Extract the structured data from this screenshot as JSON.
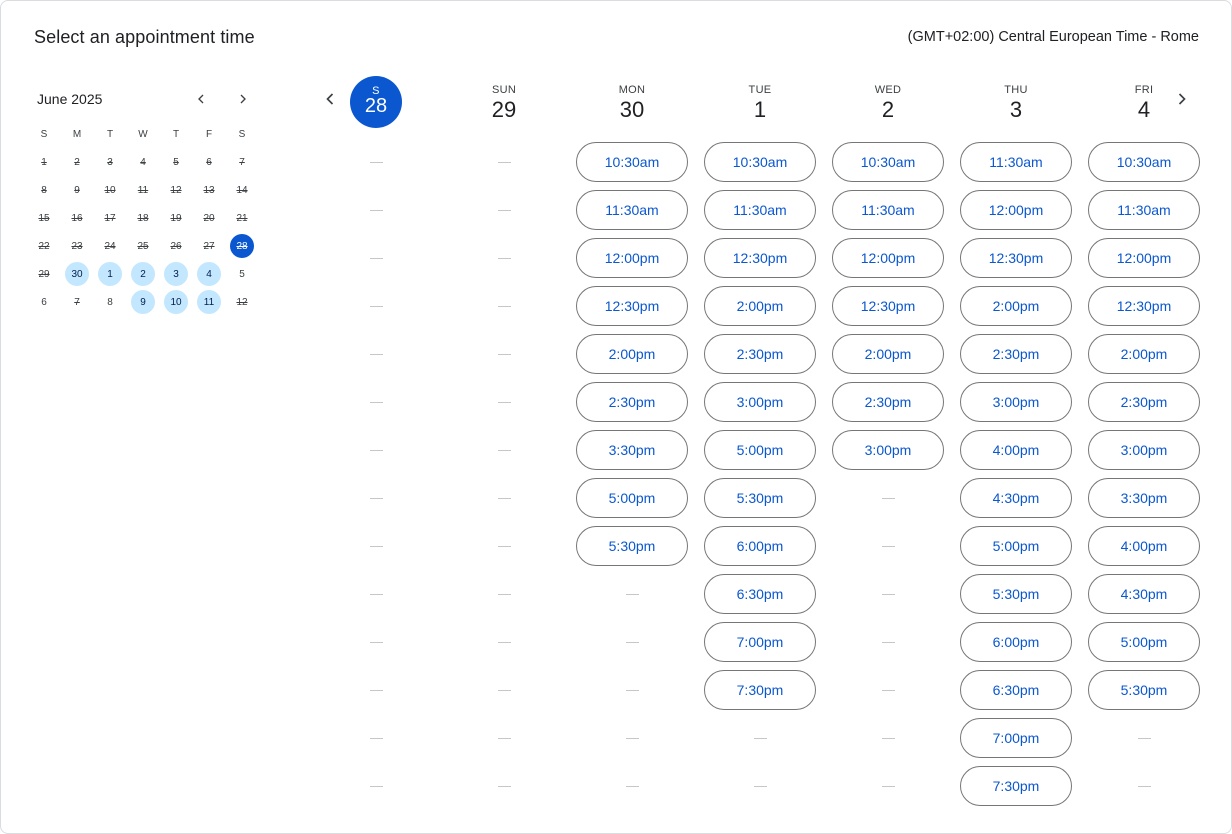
{
  "header": {
    "title": "Select an appointment time",
    "timezone": "(GMT+02:00) Central European Time - Rome"
  },
  "mini_calendar": {
    "month_label": "June 2025",
    "prev_icon": "chevron-left-icon",
    "next_icon": "chevron-right-icon",
    "weekdays": [
      "S",
      "M",
      "T",
      "W",
      "T",
      "F",
      "S"
    ],
    "weeks": [
      [
        {
          "d": "1",
          "s": "unavail"
        },
        {
          "d": "2",
          "s": "unavail"
        },
        {
          "d": "3",
          "s": "unavail"
        },
        {
          "d": "4",
          "s": "unavail"
        },
        {
          "d": "5",
          "s": "unavail"
        },
        {
          "d": "6",
          "s": "unavail"
        },
        {
          "d": "7",
          "s": "unavail"
        }
      ],
      [
        {
          "d": "8",
          "s": "unavail"
        },
        {
          "d": "9",
          "s": "unavail"
        },
        {
          "d": "10",
          "s": "unavail"
        },
        {
          "d": "11",
          "s": "unavail"
        },
        {
          "d": "12",
          "s": "unavail"
        },
        {
          "d": "13",
          "s": "unavail"
        },
        {
          "d": "14",
          "s": "unavail"
        }
      ],
      [
        {
          "d": "15",
          "s": "unavail"
        },
        {
          "d": "16",
          "s": "unavail"
        },
        {
          "d": "17",
          "s": "unavail"
        },
        {
          "d": "18",
          "s": "unavail"
        },
        {
          "d": "19",
          "s": "unavail"
        },
        {
          "d": "20",
          "s": "unavail"
        },
        {
          "d": "21",
          "s": "unavail"
        }
      ],
      [
        {
          "d": "22",
          "s": "unavail"
        },
        {
          "d": "23",
          "s": "unavail"
        },
        {
          "d": "24",
          "s": "unavail"
        },
        {
          "d": "25",
          "s": "unavail"
        },
        {
          "d": "26",
          "s": "unavail"
        },
        {
          "d": "27",
          "s": "unavail"
        },
        {
          "d": "28",
          "s": "selected"
        }
      ],
      [
        {
          "d": "29",
          "s": "unavail"
        },
        {
          "d": "30",
          "s": "avail"
        },
        {
          "d": "1",
          "s": "avail"
        },
        {
          "d": "2",
          "s": "avail"
        },
        {
          "d": "3",
          "s": "avail"
        },
        {
          "d": "4",
          "s": "avail"
        },
        {
          "d": "5",
          "s": "plain"
        }
      ],
      [
        {
          "d": "6",
          "s": "plain"
        },
        {
          "d": "7",
          "s": "unavail"
        },
        {
          "d": "8",
          "s": "plain"
        },
        {
          "d": "9",
          "s": "avail"
        },
        {
          "d": "10",
          "s": "avail"
        },
        {
          "d": "11",
          "s": "avail"
        },
        {
          "d": "12",
          "s": "unavail"
        }
      ]
    ]
  },
  "week": {
    "prev_icon": "chevron-left-icon",
    "next_icon": "chevron-right-icon",
    "days": [
      {
        "dow": "S",
        "num": "28",
        "today": true,
        "slots": []
      },
      {
        "dow": "SUN",
        "num": "29",
        "slots": []
      },
      {
        "dow": "MON",
        "num": "30",
        "slots": [
          "10:30am",
          "11:30am",
          "12:00pm",
          "12:30pm",
          "2:00pm",
          "2:30pm",
          "3:30pm",
          "5:00pm",
          "5:30pm"
        ]
      },
      {
        "dow": "TUE",
        "num": "1",
        "slots": [
          "10:30am",
          "11:30am",
          "12:30pm",
          "2:00pm",
          "2:30pm",
          "3:00pm",
          "5:00pm",
          "5:30pm",
          "6:00pm",
          "6:30pm",
          "7:00pm",
          "7:30pm"
        ]
      },
      {
        "dow": "WED",
        "num": "2",
        "slots": [
          "10:30am",
          "11:30am",
          "12:00pm",
          "12:30pm",
          "2:00pm",
          "2:30pm",
          "3:00pm"
        ]
      },
      {
        "dow": "THU",
        "num": "3",
        "slots": [
          "11:30am",
          "12:00pm",
          "12:30pm",
          "2:00pm",
          "2:30pm",
          "3:00pm",
          "4:00pm",
          "4:30pm",
          "5:00pm",
          "5:30pm",
          "6:00pm",
          "6:30pm",
          "7:00pm",
          "7:30pm"
        ]
      },
      {
        "dow": "FRI",
        "num": "4",
        "slots": [
          "10:30am",
          "11:30am",
          "12:00pm",
          "12:30pm",
          "2:00pm",
          "2:30pm",
          "3:00pm",
          "3:30pm",
          "4:00pm",
          "4:30pm",
          "5:00pm",
          "5:30pm"
        ]
      }
    ]
  },
  "colors": {
    "accent": "#0b57d0",
    "available_day": "#c2e7ff",
    "border": "#747775"
  }
}
